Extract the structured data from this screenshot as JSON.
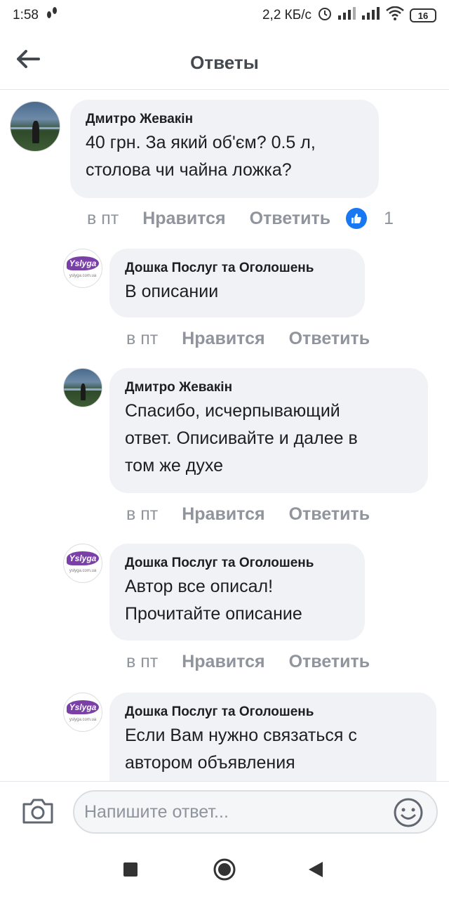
{
  "status_bar": {
    "time": "1:58",
    "network_speed": "2,2 КБ/с",
    "battery": "16"
  },
  "header": {
    "title": "Ответы"
  },
  "comments": [
    {
      "author": "Дмитро Жевакін",
      "text": "40 грн. За який об'єм? 0.5 л,\nстолова чи чайна ложка?",
      "time": "в пт",
      "like_label": "Нравится",
      "reply_label": "Ответить",
      "reaction_count": "1"
    },
    {
      "author": "Дошка Послуг та Оголошень",
      "text": "В описании",
      "time": "в пт",
      "like_label": "Нравится",
      "reply_label": "Ответить"
    },
    {
      "author": "Дмитро Жевакін",
      "text": "Спасибо, исчерпывающий\nответ. Описивайте и далее в\nтом же духе",
      "time": "в пт",
      "like_label": "Нравится",
      "reply_label": "Ответить"
    },
    {
      "author": "Дошка Послуг та Оголошень",
      "text": "Автор все описал!\nПрочитайте описание",
      "time": "в пт",
      "like_label": "Нравится",
      "reply_label": "Ответить"
    },
    {
      "author": "Дошка Послуг та Оголошень",
      "text": "Если Вам нужно связаться с\nавтором объявления"
    }
  ],
  "page_logo": {
    "brand": "Yslyga",
    "site": "yslyga.com.ua"
  },
  "composer": {
    "placeholder": "Напишите ответ..."
  },
  "colors": {
    "bubble": "#f0f2f5",
    "meta_text": "#90949c",
    "like_blue": "#1877f2",
    "logo_purple": "#7b3fa8"
  },
  "icons": [
    "back-arrow-icon",
    "thumbs-up-icon",
    "camera-icon",
    "emoji-icon",
    "recents-icon",
    "home-icon",
    "back-nav-icon"
  ]
}
